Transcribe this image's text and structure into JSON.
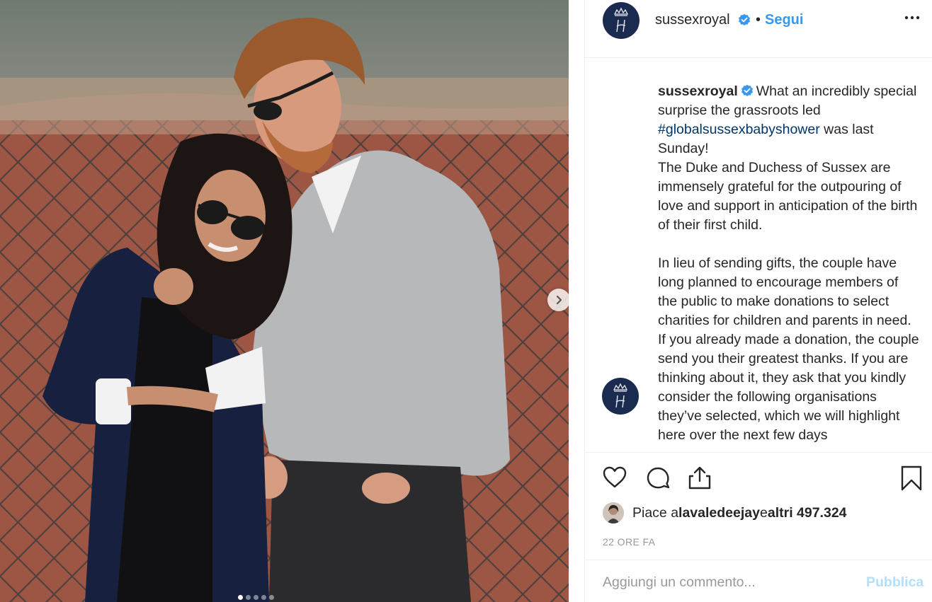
{
  "post": {
    "author": "sussexroyal",
    "follow_label": "Segui",
    "separator": "•",
    "more_label": "•••",
    "verified": true
  },
  "caption": {
    "author": "sussexroyal",
    "text_1": "What an incredibly special surprise the grassroots led ",
    "hashtag": "#globalsussexbabyshower",
    "text_2": " was last Sunday!\nThe Duke and Duchess of Sussex are immensely grateful for the outpouring of love and support in anticipation of the birth of their first child.\n\nIn lieu of sending gifts, the couple have long planned to encourage members of the public to make donations to select charities for children and parents in need. If you already made a donation, the couple send you their greatest thanks. If you are thinking about it, they ask that you kindly consider the following organisations they’ve selected, which we will highlight here over the next few days"
  },
  "likes": {
    "prefix": "Piace a ",
    "user": "lavaledeejay",
    "middle": " e ",
    "count": "altri 497.324"
  },
  "timestamp": "22 ORE FA",
  "comment": {
    "placeholder": "Aggiungi un commento...",
    "publish_label": "Pubblica"
  },
  "carousel": {
    "slide_count": 5,
    "active_slide": 1
  },
  "colors": {
    "link_blue": "#3897f0",
    "hashtag": "#003569",
    "muted": "#999999",
    "publish_disabled": "#b2dffc",
    "avatar_navy": "#1b2b4f"
  },
  "icons": {
    "like": "heart-icon",
    "comment": "comment-icon",
    "share": "share-icon",
    "save": "bookmark-icon",
    "verified": "verified-badge-icon",
    "next": "chevron-right-icon"
  }
}
